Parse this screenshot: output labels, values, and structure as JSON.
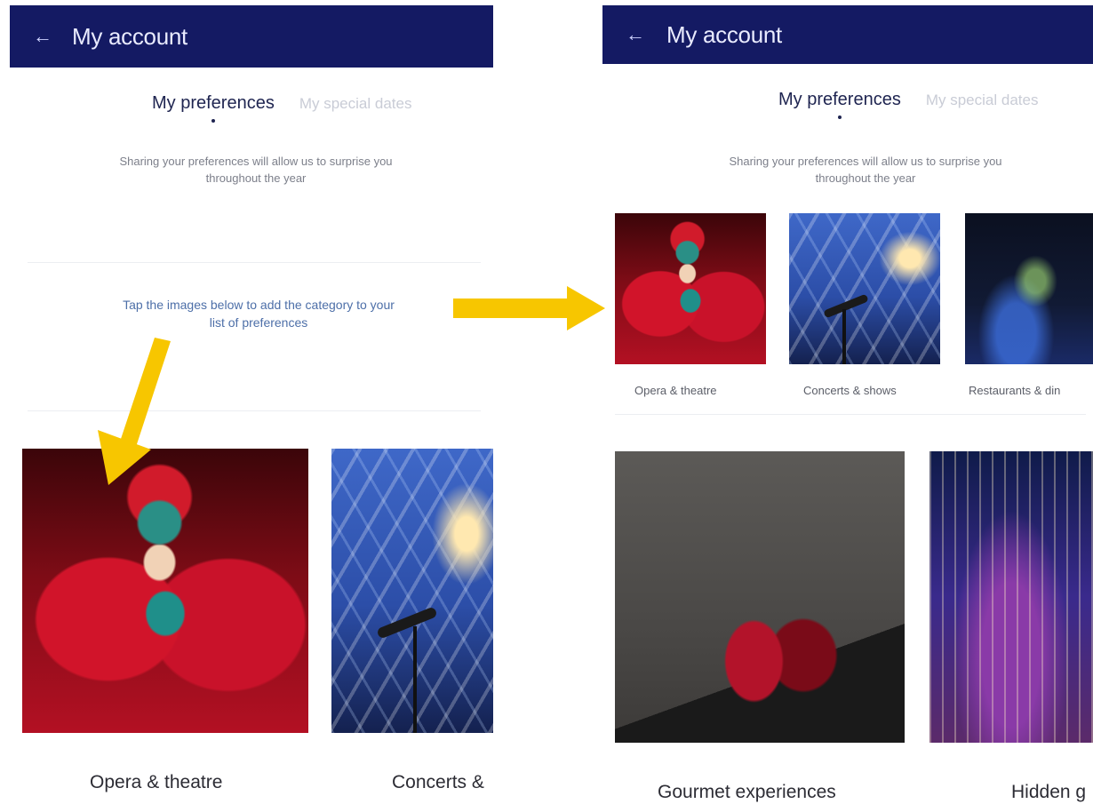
{
  "left": {
    "header": {
      "title": "My account",
      "back_icon": "arrow-left-icon"
    },
    "tabs": [
      {
        "label": "My preferences",
        "active": true
      },
      {
        "label": "My special dates",
        "active": false
      }
    ],
    "intro": {
      "line1": "Sharing your preferences will allow us to surprise you",
      "line2": "throughout the year"
    },
    "hint": {
      "line1": "Tap the images below to add the category to your",
      "line2": "list of preferences"
    },
    "cards": [
      {
        "label": "Opera & theatre"
      },
      {
        "label": "Concerts &"
      }
    ]
  },
  "right": {
    "header": {
      "title": "My account",
      "back_icon": "arrow-left-icon"
    },
    "tabs": [
      {
        "label": "My preferences",
        "active": true
      },
      {
        "label": "My special dates",
        "active": false
      }
    ],
    "intro": {
      "line1": "Sharing your preferences will allow us to surprise you",
      "line2": "throughout the year"
    },
    "selected": [
      {
        "label": "Opera & theatre"
      },
      {
        "label": "Concerts & shows"
      },
      {
        "label": "Restaurants & din"
      }
    ],
    "cards": [
      {
        "label": "Gourmet experiences"
      },
      {
        "label": "Hidden g"
      }
    ]
  },
  "colors": {
    "header_bg": "#141a63",
    "hint_text": "#4d6fa8",
    "arrow": "#f7c600"
  }
}
